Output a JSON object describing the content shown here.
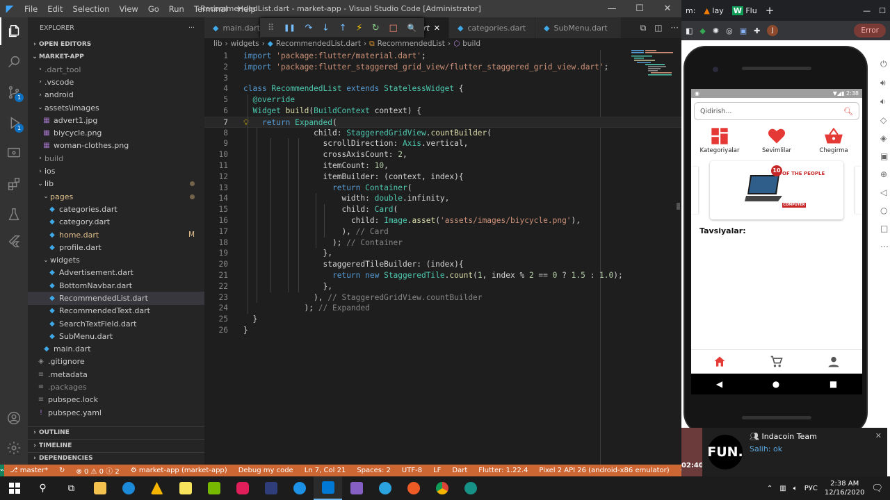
{
  "menu": [
    "File",
    "Edit",
    "Selection",
    "View",
    "Go",
    "Run",
    "Terminal",
    "Help"
  ],
  "window_title": "RecommendedList.dart - market-app - Visual Studio Code [Administrator]",
  "window_controls": [
    "—",
    "☐",
    "✕"
  ],
  "activity_badges": {
    "source_control": "1",
    "debug": "1"
  },
  "explorer": {
    "title": "EXPLORER",
    "more": "···",
    "open_editors": "OPEN EDITORS",
    "project": "MARKET-APP",
    "tree": [
      {
        "label": ".dart_tool",
        "depth": 1,
        "chev": "›",
        "style": "dim"
      },
      {
        "label": ".vscode",
        "depth": 1,
        "chev": "›",
        "style": "normal"
      },
      {
        "label": "android",
        "depth": 1,
        "chev": "›",
        "style": "normal"
      },
      {
        "label": "assets\\images",
        "depth": 1,
        "chev": "⌄",
        "style": "normal"
      },
      {
        "label": "advert1.jpg",
        "depth": 2,
        "icon": "img",
        "style": "normal"
      },
      {
        "label": "biycycle.png",
        "depth": 2,
        "icon": "img",
        "style": "normal"
      },
      {
        "label": "woman-clothes.png",
        "depth": 2,
        "icon": "img",
        "style": "normal"
      },
      {
        "label": "build",
        "depth": 1,
        "chev": "›",
        "style": "dim"
      },
      {
        "label": "ios",
        "depth": 1,
        "chev": "›",
        "style": "normal"
      },
      {
        "label": "lib",
        "depth": 1,
        "chev": "⌄",
        "style": "normal",
        "dot": true
      },
      {
        "label": "pages",
        "depth": 2,
        "chev": "⌄",
        "style": "modified",
        "dot": true
      },
      {
        "label": "categories.dart",
        "depth": 3,
        "icon": "dart",
        "style": "normal"
      },
      {
        "label": "category.dart",
        "depth": 3,
        "icon": "dart",
        "style": "normal"
      },
      {
        "label": "home.dart",
        "depth": 3,
        "icon": "dart",
        "style": "modified",
        "mod": "M"
      },
      {
        "label": "profile.dart",
        "depth": 3,
        "icon": "dart",
        "style": "normal"
      },
      {
        "label": "widgets",
        "depth": 2,
        "chev": "⌄",
        "style": "normal"
      },
      {
        "label": "Advertisement.dart",
        "depth": 3,
        "icon": "dart",
        "style": "normal"
      },
      {
        "label": "BottomNavbar.dart",
        "depth": 3,
        "icon": "dart",
        "style": "normal"
      },
      {
        "label": "RecommendedList.dart",
        "depth": 3,
        "icon": "dart",
        "style": "normal",
        "selected": true
      },
      {
        "label": "RecommendedText.dart",
        "depth": 3,
        "icon": "dart",
        "style": "normal"
      },
      {
        "label": "SearchTextField.dart",
        "depth": 3,
        "icon": "dart",
        "style": "normal"
      },
      {
        "label": "SubMenu.dart",
        "depth": 3,
        "icon": "dart",
        "style": "normal"
      },
      {
        "label": "main.dart",
        "depth": 2,
        "icon": "dart",
        "style": "normal"
      },
      {
        "label": ".gitignore",
        "depth": 1,
        "icon": "git",
        "style": "normal"
      },
      {
        "label": ".metadata",
        "depth": 1,
        "icon": "file",
        "style": "normal"
      },
      {
        "label": ".packages",
        "depth": 1,
        "icon": "file",
        "style": "dim"
      },
      {
        "label": "pubspec.lock",
        "depth": 1,
        "icon": "file",
        "style": "normal"
      },
      {
        "label": "pubspec.yaml",
        "depth": 1,
        "icon": "yaml",
        "style": "normal"
      }
    ],
    "sections": [
      "OUTLINE",
      "TIMELINE",
      "DEPENDENCIES"
    ]
  },
  "tabs": [
    {
      "label": "main.dart",
      "active": false
    },
    {
      "label": "dart",
      "active": true,
      "close": "✕"
    },
    {
      "label": "categories.dart",
      "active": false
    },
    {
      "label": "SubMenu.dart",
      "active": false
    }
  ],
  "debug_toolbar": [
    "⠿",
    "❚❚",
    "↷",
    "↓",
    "↑",
    "⚡",
    "↻",
    "□",
    "🔍"
  ],
  "breadcrumb": [
    "lib",
    "widgets",
    "RecommendedList.dart",
    "RecommendedList",
    "build"
  ],
  "current_line": 7,
  "code_lines": [
    [
      [
        "kw",
        "import "
      ],
      [
        "str",
        "'package:flutter/material.dart'"
      ],
      [
        "txt",
        ";"
      ]
    ],
    [
      [
        "kw",
        "import "
      ],
      [
        "str",
        "'package:flutter_staggered_grid_view/flutter_staggered_grid_view.dart'"
      ],
      [
        "txt",
        ";"
      ]
    ],
    [],
    [
      [
        "kw",
        "class "
      ],
      [
        "ty",
        "RecommendedList "
      ],
      [
        "kw",
        "extends "
      ],
      [
        "ty",
        "StatelessWidget "
      ],
      [
        "txt",
        "{"
      ]
    ],
    [
      [
        "txt",
        "  "
      ],
      [
        "ann",
        "@override"
      ]
    ],
    [
      [
        "txt",
        "  "
      ],
      [
        "ty",
        "Widget "
      ],
      [
        "fn",
        "build"
      ],
      [
        "txt",
        "("
      ],
      [
        "ty",
        "BuildContext "
      ],
      [
        "txt",
        "context) {"
      ]
    ],
    [
      [
        "txt",
        "    "
      ],
      [
        "kw",
        "return "
      ],
      [
        "ty",
        "Expanded"
      ],
      [
        "txt",
        "("
      ]
    ],
    [
      [
        "txt",
        "               child: "
      ],
      [
        "ty",
        "StaggeredGridView"
      ],
      [
        "txt",
        "."
      ],
      [
        "fn",
        "countBuilder"
      ],
      [
        "txt",
        "("
      ]
    ],
    [
      [
        "txt",
        "                 scrollDirection: "
      ],
      [
        "ty",
        "Axis"
      ],
      [
        "txt",
        ".vertical,"
      ]
    ],
    [
      [
        "txt",
        "                 crossAxisCount: "
      ],
      [
        "num",
        "2"
      ],
      [
        "txt",
        ","
      ]
    ],
    [
      [
        "txt",
        "                 itemCount: "
      ],
      [
        "num",
        "10"
      ],
      [
        "txt",
        ","
      ]
    ],
    [
      [
        "txt",
        "                 itemBuilder: (context, index){"
      ]
    ],
    [
      [
        "txt",
        "                   "
      ],
      [
        "kw",
        "return "
      ],
      [
        "ty",
        "Container"
      ],
      [
        "txt",
        "("
      ]
    ],
    [
      [
        "txt",
        "                     width: "
      ],
      [
        "ty",
        "double"
      ],
      [
        "txt",
        ".infinity,"
      ]
    ],
    [
      [
        "txt",
        "                     child: "
      ],
      [
        "ty",
        "Card"
      ],
      [
        "txt",
        "("
      ]
    ],
    [
      [
        "txt",
        "                       child: "
      ],
      [
        "ty",
        "Image"
      ],
      [
        "txt",
        "."
      ],
      [
        "fn",
        "asset"
      ],
      [
        "txt",
        "("
      ],
      [
        "str",
        "'assets/images/biycycle.png'"
      ],
      [
        "txt",
        "),"
      ]
    ],
    [
      [
        "txt",
        "                     ), "
      ],
      [
        "cm",
        "// Card"
      ]
    ],
    [
      [
        "txt",
        "                   ); "
      ],
      [
        "cm",
        "// Container"
      ]
    ],
    [
      [
        "txt",
        "                 },"
      ]
    ],
    [
      [
        "txt",
        "                 staggeredTileBuilder: (index){"
      ]
    ],
    [
      [
        "txt",
        "                   "
      ],
      [
        "kw",
        "return new "
      ],
      [
        "ty",
        "StaggeredTile"
      ],
      [
        "txt",
        "."
      ],
      [
        "fn",
        "count"
      ],
      [
        "txt",
        "("
      ],
      [
        "num",
        "1"
      ],
      [
        "txt",
        ", index % "
      ],
      [
        "num",
        "2"
      ],
      [
        "txt",
        " == "
      ],
      [
        "num",
        "0"
      ],
      [
        "txt",
        " ? "
      ],
      [
        "num",
        "1.5"
      ],
      [
        "txt",
        " : "
      ],
      [
        "num",
        "1.0"
      ],
      [
        "txt",
        ");"
      ]
    ],
    [
      [
        "txt",
        "                 },"
      ]
    ],
    [
      [
        "txt",
        "               ), "
      ],
      [
        "cm",
        "// StaggeredGridView.countBuilder"
      ]
    ],
    [
      [
        "txt",
        "             ); "
      ],
      [
        "cm",
        "// Expanded"
      ]
    ],
    [
      [
        "txt",
        "  }"
      ]
    ],
    [
      [
        "txt",
        "}"
      ]
    ]
  ],
  "statusbar": {
    "remote": "⌁",
    "branch": "⎇ master*",
    "sync": "↻",
    "problems": "⊗ 0 ⚠ 0 ⓘ 2",
    "debug": "⚙ market-app (market-app)",
    "debug_label": "Debug my code",
    "position": "Ln 7, Col 21",
    "spaces": "Spaces: 2",
    "encoding": "UTF-8",
    "eol": "LF",
    "language": "Dart",
    "flutter": "Flutter: 1.22.4",
    "device": "Pixel 2 API 26 (android-x86 emulator)"
  },
  "browser": {
    "tabs": [
      "m:",
      "lay",
      "Flu"
    ],
    "new_tab": "+",
    "error_label": "Error",
    "avatar": "J"
  },
  "emulator": {
    "time": "2:38",
    "search_placeholder": "Qidirish...",
    "submenu": [
      {
        "label": "Kategoriyalar",
        "icon": "grid-icon"
      },
      {
        "label": "Sevimlilar",
        "icon": "heart-icon"
      },
      {
        "label": "Chegirma",
        "icon": "basket-icon"
      }
    ],
    "advert_text": "OF THE PEOPLE",
    "advert_brand": "COMPUTER",
    "advert_num": "10",
    "recommended_title": "Tavsiyalar:",
    "colors": {
      "accent": "#e53935"
    }
  },
  "notification": {
    "app_logo": "FUN.",
    "title": "Indacoin Team",
    "message": "Salih: ok",
    "close": "✕",
    "strip_time": "02:40"
  },
  "tray": {
    "lang": "РУС",
    "time": "2:38 AM",
    "date": "12/16/2020"
  }
}
